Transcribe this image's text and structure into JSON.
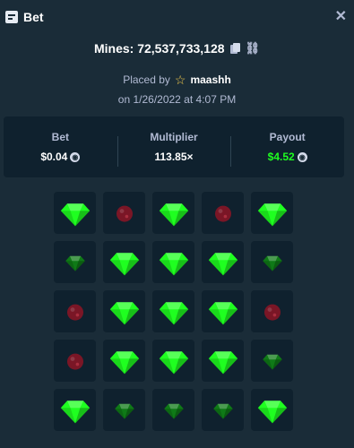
{
  "header": {
    "title": "Bet",
    "icon": "bet-icon",
    "close_icon": "close-icon"
  },
  "info": {
    "mines_text": "Mines: 72,537,733,128",
    "placed_by_label": "Placed by",
    "username": "maashh",
    "date_text": "on 1/26/2022 at 4:07 PM"
  },
  "stats": {
    "bet": {
      "label": "Bet",
      "value": "$0.04"
    },
    "multiplier": {
      "label": "Multiplier",
      "value": "113.85×"
    },
    "payout": {
      "label": "Payout",
      "value": "$4.52"
    }
  },
  "colors": {
    "background": "#1a2c38",
    "panel": "#0f212e",
    "gem_revealed": "#1fff20",
    "gem_dim": "#0f7a17",
    "mine_dim": "#7a1626",
    "payout_green": "#1fff20"
  },
  "grid": [
    [
      "gem",
      "mine",
      "gem",
      "mine",
      "gem"
    ],
    [
      "gem-dim",
      "gem",
      "gem",
      "gem",
      "gem-dim"
    ],
    [
      "mine",
      "gem",
      "gem",
      "gem",
      "mine"
    ],
    [
      "mine",
      "gem",
      "gem",
      "gem",
      "gem-dim"
    ],
    [
      "gem",
      "gem-dim",
      "gem-dim",
      "gem-dim",
      "gem"
    ]
  ]
}
